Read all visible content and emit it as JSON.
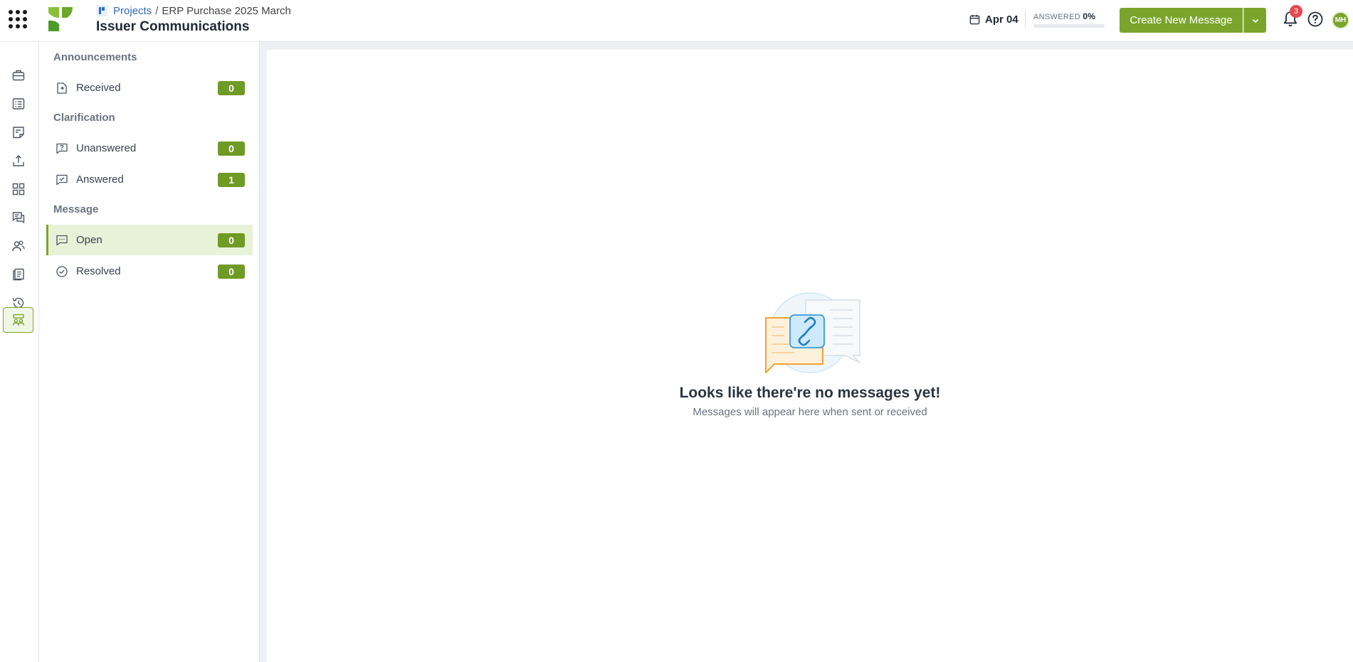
{
  "header": {
    "breadcrumb_root": "Projects",
    "breadcrumb_separator": "/",
    "breadcrumb_current": "ERP Purchase 2025 March",
    "title": "Issuer Communications",
    "date": "Apr 04",
    "answered_label": "ANSWERED",
    "answered_value": "0%",
    "answered_fraction": 0,
    "create_button": "Create New Message",
    "notification_count": "3",
    "avatar_initials": "MH"
  },
  "rail": {
    "items": [
      {
        "icon": "briefcase-icon"
      },
      {
        "icon": "list-icon"
      },
      {
        "icon": "document-icon"
      },
      {
        "icon": "upload-icon"
      },
      {
        "icon": "dashboard-icon"
      },
      {
        "icon": "chat-icon"
      },
      {
        "icon": "users-icon"
      },
      {
        "icon": "pages-icon"
      },
      {
        "icon": "history-icon"
      },
      {
        "icon": "issuer-communications-icon",
        "active": true
      }
    ]
  },
  "nav": {
    "announcements": {
      "title": "Announcements",
      "items": [
        {
          "label": "Received",
          "count": "0",
          "icon": "received-icon"
        }
      ]
    },
    "clarification": {
      "title": "Clarification",
      "items": [
        {
          "label": "Unanswered",
          "count": "0",
          "icon": "question-message-icon"
        },
        {
          "label": "Answered",
          "count": "1",
          "icon": "check-message-icon"
        }
      ]
    },
    "message": {
      "title": "Message",
      "items": [
        {
          "label": "Open",
          "count": "0",
          "icon": "open-message-icon",
          "active": true
        },
        {
          "label": "Resolved",
          "count": "0",
          "icon": "check-circle-icon"
        }
      ]
    }
  },
  "empty_state": {
    "title": "Looks like there're no messages yet!",
    "subtitle": "Messages will appear here when sent or received"
  },
  "colors": {
    "accent": "#7aa52c",
    "badge": "#6f9a24",
    "active_bg": "#e8f2d8",
    "notification": "#e5484d"
  }
}
